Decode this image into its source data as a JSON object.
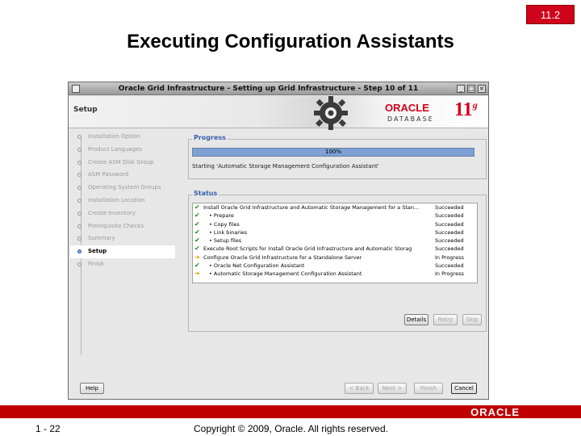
{
  "slide": {
    "section_badge": "11.2",
    "title": "Executing Configuration Assistants",
    "slide_number": "1 - 22",
    "copyright": "Copyright © 2009, Oracle. All rights reserved.",
    "footer_logo": "ORACLE"
  },
  "window": {
    "title": "Oracle Grid Infrastructure - Setting up Grid Infrastructure - Step 10 of 11",
    "controls": {
      "minimize": "_",
      "maximize": "□",
      "close": "×"
    }
  },
  "banner": {
    "page_label": "Setup",
    "brand": "ORACLE",
    "product": "DATABASE",
    "version": "11",
    "version_suffix": "g"
  },
  "steps": [
    {
      "label": "Installation Option",
      "active": false
    },
    {
      "label": "Product Languages",
      "active": false
    },
    {
      "label": "Create ASM Disk Group",
      "active": false
    },
    {
      "label": "ASM Password",
      "active": false
    },
    {
      "label": "Operating System Groups",
      "active": false
    },
    {
      "label": "Installation Location",
      "active": false
    },
    {
      "label": "Create Inventory",
      "active": false
    },
    {
      "label": "Prerequisite Checks",
      "active": false
    },
    {
      "label": "Summary",
      "active": false
    },
    {
      "label": "Setup",
      "active": true
    },
    {
      "label": "Finish",
      "active": false
    }
  ],
  "progress": {
    "legend": "Progress",
    "percent_label": "100%",
    "percent": 100,
    "status_text": "Starting 'Automatic Storage Management Configuration Assistant'"
  },
  "status": {
    "legend": "Status",
    "rows": [
      {
        "name": "Install Oracle Grid Infrastructure and Automatic Storage Management for a Stan...",
        "state": "Succeeded",
        "icon": "check-icon",
        "sub": false
      },
      {
        "name": "Prepare",
        "state": "Succeeded",
        "icon": "check-icon",
        "sub": true
      },
      {
        "name": "Copy files",
        "state": "Succeeded",
        "icon": "check-icon",
        "sub": true
      },
      {
        "name": "Link binaries",
        "state": "Succeeded",
        "icon": "check-icon",
        "sub": true
      },
      {
        "name": "Setup files",
        "state": "Succeeded",
        "icon": "check-icon",
        "sub": true
      },
      {
        "name": "Execute Root Scripts for Install Oracle Grid Infrastructure and Automatic Storag",
        "state": "Succeeded",
        "icon": "check-icon",
        "sub": false
      },
      {
        "name": "Configure Oracle Grid Infrastructure for a Standalone Server",
        "state": "In Progress",
        "icon": "arrow-icon",
        "sub": false
      },
      {
        "name": "Oracle Net Configuration Assistant",
        "state": "Succeeded",
        "icon": "check-icon",
        "sub": true
      },
      {
        "name": "Automatic Storage Management Configuration Assistant",
        "state": "In Progress",
        "icon": "arrow-icon",
        "sub": true
      }
    ]
  },
  "buttons": {
    "details": "Details",
    "retry": "Retry",
    "skip": "Skip",
    "help": "Help",
    "back": "< Back",
    "next": "Next >",
    "finish": "Finish",
    "cancel": "Cancel"
  }
}
